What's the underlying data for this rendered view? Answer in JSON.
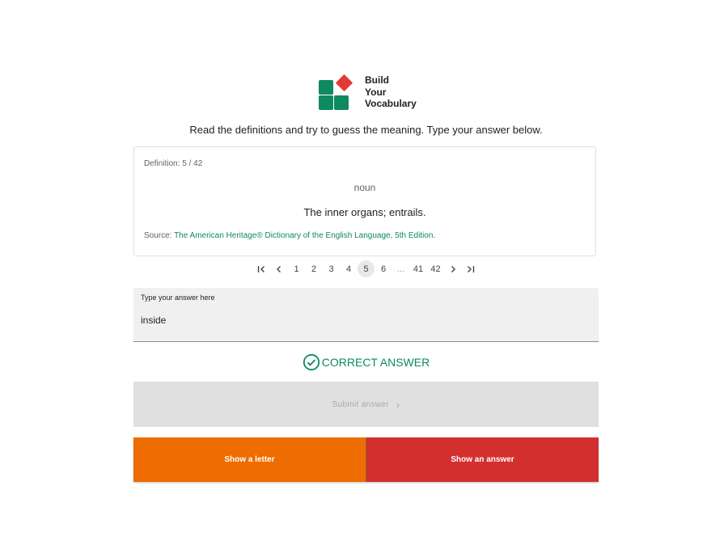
{
  "brand": {
    "line1": "Build",
    "line2": "Your",
    "line3": "Vocabulary"
  },
  "instructions": "Read the definitions and try to guess the meaning. Type your answer below.",
  "card": {
    "counter": "Definition: 5 / 42",
    "part_of_speech": "noun",
    "definition": "The inner organs; entrails.",
    "source_label": "Source:",
    "source_link": "The American Heritage® Dictionary of the English Language, 5th Edition."
  },
  "pagination": {
    "pages": [
      "1",
      "2",
      "3",
      "4",
      "5",
      "6",
      "...",
      "41",
      "42"
    ],
    "current": "5"
  },
  "answer": {
    "label": "Type your answer here",
    "value": "inside"
  },
  "result": {
    "text": "CORRECT ANSWER",
    "color": "#0d8a5e"
  },
  "submit": {
    "label": "Submit answer"
  },
  "actions": {
    "show_letter": "Show a letter",
    "show_answer": "Show an answer"
  },
  "colors": {
    "brand_green": "#0d8a5e",
    "brand_red": "#e53935",
    "orange": "#ee6c00",
    "red": "#d32f2f"
  }
}
